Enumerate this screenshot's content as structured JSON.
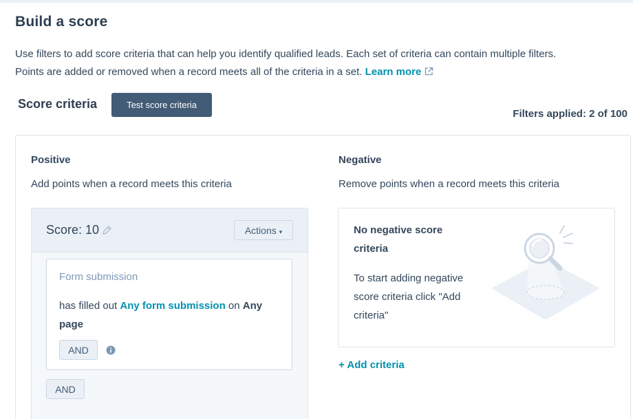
{
  "page": {
    "title": "Build a score",
    "description_line1": "Use filters to add score criteria that can help you identify qualified leads. Each set of criteria can contain multiple filters.",
    "description_line2": "Points are added or removed when a record meets all of the criteria in a set.",
    "learn_more_label": "Learn more"
  },
  "criteria_header": {
    "title": "Score criteria",
    "test_button_label": "Test score criteria",
    "filters_applied": "Filters applied: 2 of 100"
  },
  "positive": {
    "heading": "Positive",
    "subtitle": "Add points when a record meets this criteria",
    "score_label": "Score: 10",
    "actions_label": "Actions",
    "filter": {
      "type": "Form submission",
      "text_1": "has filled out ",
      "link_1": "Any form submission",
      "text_2": " on ",
      "bold_value": "Any page"
    },
    "inner_and_label": "AND",
    "outer_and_label": "AND"
  },
  "negative": {
    "heading": "Negative",
    "subtitle": "Remove points when a record meets this criteria",
    "empty_title": "No negative score criteria",
    "empty_body": "To start adding negative score criteria click \"Add criteria\"",
    "add_criteria_label": "+ Add criteria"
  },
  "icons": {
    "external_link": "external-link-icon",
    "edit": "pencil-icon",
    "caret": "caret-down-icon",
    "info": "info-icon",
    "empty_state": "magnifier-illustration"
  },
  "colors": {
    "accent": "#0091ae",
    "primary_button": "#425b76",
    "text": "#33475b",
    "muted_text": "#7c98b6",
    "header_bg": "#eaf0f6"
  }
}
